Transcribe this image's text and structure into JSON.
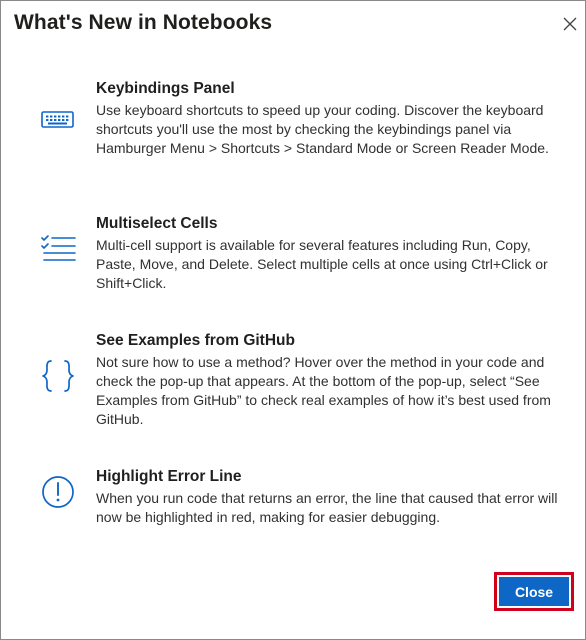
{
  "dialog": {
    "title": "What's New in Notebooks",
    "close_button_label": "Close"
  },
  "colors": {
    "accent": "#0e66c7",
    "highlight_border": "#d0021b",
    "text": "#201f1e"
  },
  "features": [
    {
      "icon": "keyboard-icon",
      "heading": "Keybindings Panel",
      "description": "Use keyboard shortcuts to speed up your coding. Discover the keyboard shortcuts you'll use the most by checking the keybindings panel via Hamburger Menu > Shortcuts > Standard Mode or Screen Reader Mode."
    },
    {
      "icon": "multiselect-list-icon",
      "heading": "Multiselect Cells",
      "description": "Multi-cell support is available for several features including Run, Copy, Paste, Move, and Delete. Select multiple cells at once using Ctrl+Click or Shift+Click."
    },
    {
      "icon": "curly-braces-icon",
      "heading": "See Examples from GitHub",
      "description": "Not sure how to use a method? Hover over the method in your code and check the pop-up that appears. At the bottom of the pop-up, select “See Examples from GitHub” to check real examples of how it’s best used from GitHub."
    },
    {
      "icon": "error-info-icon",
      "heading": "Highlight Error Line",
      "description": "When you run code that returns an error, the line that caused that error will now be highlighted in red, making for easier debugging."
    }
  ]
}
